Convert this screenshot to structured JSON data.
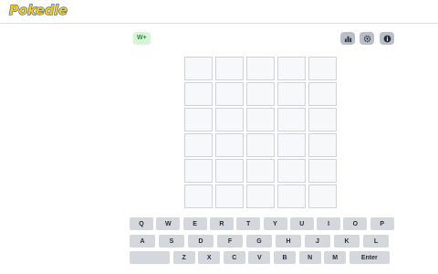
{
  "header": {
    "logo_text": "Pokedle"
  },
  "toolbar": {
    "badge_label": "W+",
    "icons": [
      "stats-icon",
      "settings-icon",
      "info-icon"
    ]
  },
  "board": {
    "rows": 6,
    "cols": 5,
    "cells": []
  },
  "keyboard": {
    "row1": [
      "Q",
      "W",
      "E",
      "R",
      "T",
      "Y",
      "U",
      "I",
      "O",
      "P"
    ],
    "row2": [
      "A",
      "S",
      "D",
      "F",
      "G",
      "H",
      "J",
      "K",
      "L"
    ],
    "row3": [
      "",
      "Z",
      "X",
      "C",
      "V",
      "B",
      "N",
      "M",
      "Enter"
    ]
  },
  "colors": {
    "key": "#d4d7dc",
    "badge_bg": "#d9f5d9",
    "badge_text": "#2e8b3a",
    "icon_bg": "#b9bfca"
  }
}
